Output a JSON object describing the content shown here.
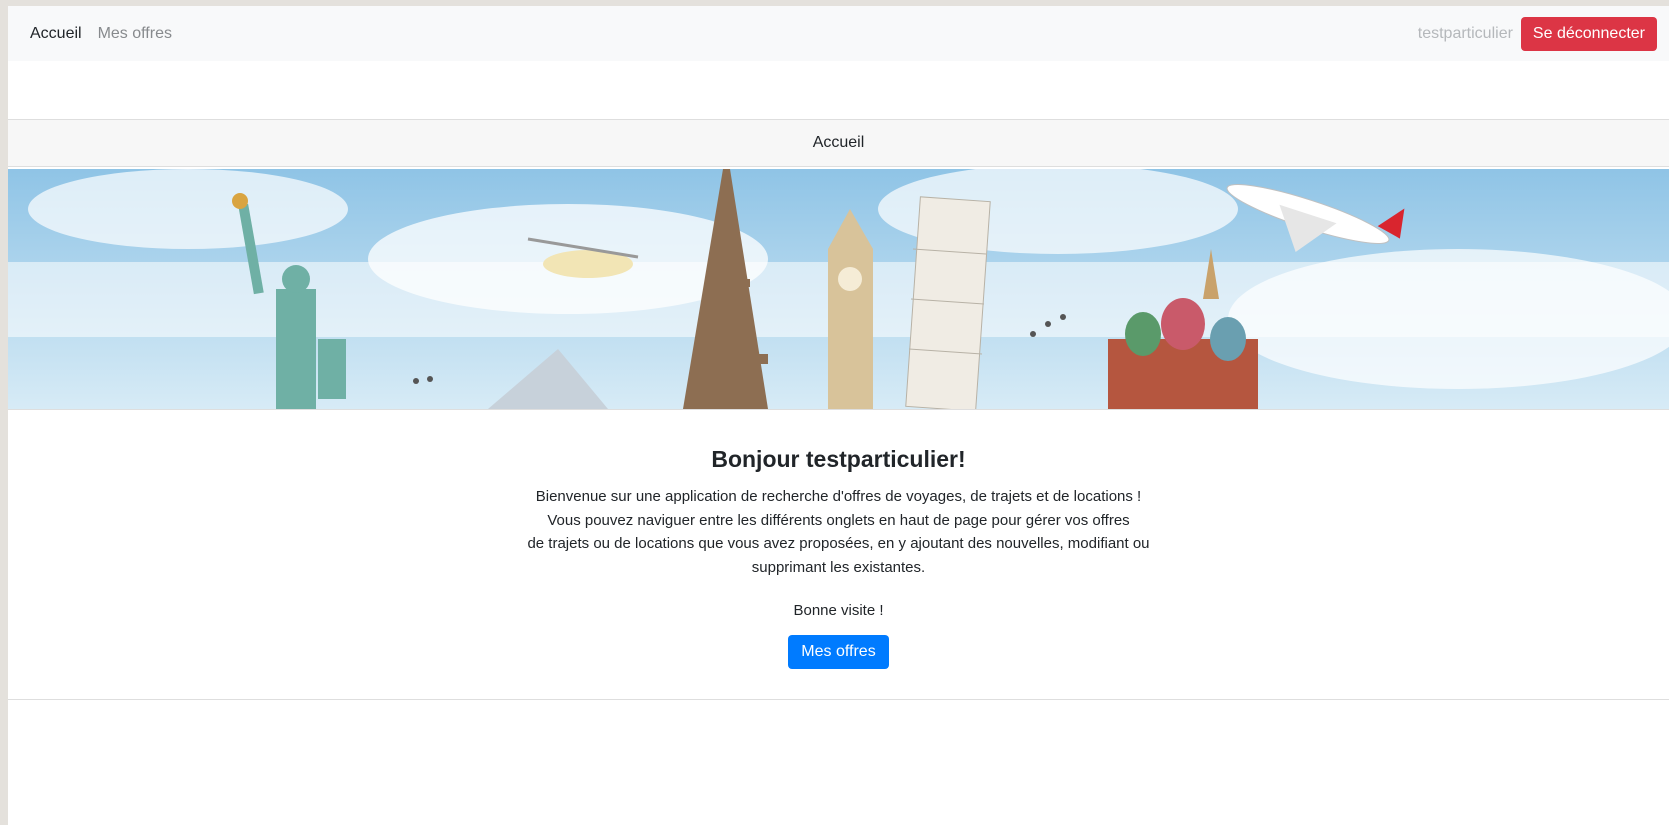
{
  "navbar": {
    "links": [
      {
        "label": "Accueil"
      },
      {
        "label": "Mes offres"
      }
    ],
    "username": "testparticulier",
    "logout_label": "Se déconnecter"
  },
  "header": {
    "title": "Accueil"
  },
  "banner": {
    "image": "travel-landmarks-banner"
  },
  "main": {
    "greeting": "Bonjour testparticulier!",
    "description_lines": [
      "Bienvenue sur une application de recherche d'offres de voyages, de trajets et de locations !",
      "Vous pouvez naviguer entre les différents onglets en haut de page pour gérer vos offres",
      "de trajets ou de locations que vous avez proposées, en y ajoutant des nouvelles, modifiant ou",
      "supprimant les existantes."
    ],
    "farewell": "Bonne visite !",
    "offers_button": "Mes offres"
  },
  "colors": {
    "logout_button": "#dc3545",
    "primary_button": "#007bff",
    "navbar_bg": "#f8f9fa"
  }
}
